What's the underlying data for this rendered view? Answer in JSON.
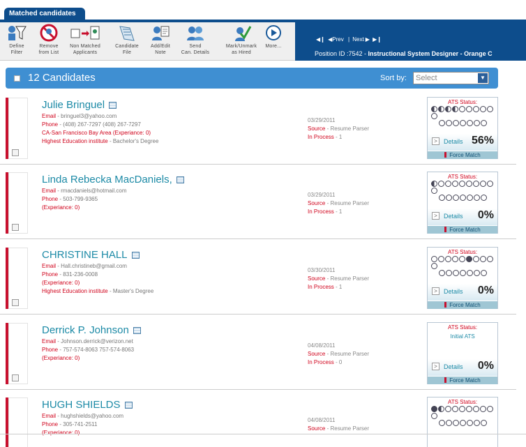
{
  "tab": {
    "label": "Matched candidates"
  },
  "toolbar": {
    "tools": [
      {
        "id": "define-filter",
        "line1": "Define",
        "line2": "Filter"
      },
      {
        "id": "remove-from-list",
        "line1": "Remove",
        "line2": "from List"
      },
      {
        "id": "non-matched",
        "line1": "Non Matched",
        "line2": "Applicants"
      },
      {
        "id": "candidate-file",
        "line1": "Candidate",
        "line2": "File"
      },
      {
        "id": "add-edit-note",
        "line1": "Add/Edit",
        "line2": "Note"
      },
      {
        "id": "send-details",
        "line1": "Send",
        "line2": "Can. Details"
      },
      {
        "id": "mark-hired",
        "line1": "Mark/Unmark",
        "line2": "as Hired"
      },
      {
        "id": "more",
        "line1": "More...",
        "line2": ""
      }
    ],
    "nav": {
      "prev": "Prev",
      "sep": "|",
      "next": "Next"
    },
    "position_label": "Position ID :7542 - ",
    "position_title": "Instructional System Designer - Orange C"
  },
  "header": {
    "count_title": "12 Candidates",
    "sort_label": "Sort by:",
    "sort_value": "Select"
  },
  "candidates": [
    {
      "name": "Julie Bringuel",
      "email_label": "Email",
      "email": "bringuel3@yahoo.com",
      "phone_label": "Phone",
      "phone": "(408) 267-7297 (408) 267-7297",
      "location": "CA-San Francisco Bay Area (Experiance: 0)",
      "edu_label": "Highest Education institute",
      "edu": "Bachelor's Degree",
      "date": "03/29/2011",
      "source_label": "Source",
      "source": "Resume Parser",
      "process_label": "In Process",
      "process": "1",
      "ats_title": "ATS Status:",
      "ats_sub": "",
      "ats_pattern": "hhhhooooooooooooo",
      "details_label": "Details",
      "match": "56%",
      "force_label": "Force Match"
    },
    {
      "name": "Linda Rebecka MacDaniels,",
      "email_label": "Email",
      "email": "rmacdaniels@hotmail.com",
      "phone_label": "Phone",
      "phone": "503-799-9365",
      "location": "(Experiance: 0)",
      "edu_label": "",
      "edu": "",
      "date": "03/29/2011",
      "source_label": "Source",
      "source": "Resume Parser",
      "process_label": "In Process",
      "process": "1",
      "ats_title": "ATS Status:",
      "ats_sub": "",
      "ats_pattern": "hoooooooooooooooo",
      "details_label": "Details",
      "match": "0%",
      "force_label": "Force Match"
    },
    {
      "name": "CHRISTINE HALL",
      "email_label": "Email",
      "email": "Hall.christineb@gmail.com",
      "phone_label": "Phone",
      "phone": "831-236-0008",
      "location": "(Experiance: 0)",
      "edu_label": "Highest Education institute",
      "edu": "Master's Degree",
      "date": "03/30/2011",
      "source_label": "Source",
      "source": "Resume Parser",
      "process_label": "In Process",
      "process": "1",
      "ats_title": "ATS Status:",
      "ats_sub": "",
      "ats_pattern": "ooooofooooooooooo",
      "details_label": "Details",
      "match": "0%",
      "force_label": "Force Match"
    },
    {
      "name": "Derrick P. Johnson",
      "email_label": "Email",
      "email": "Johnson.derrick@verizon.net",
      "phone_label": "Phone",
      "phone": "757-574-8063 757-574-8063",
      "location": "(Experiance: 0)",
      "edu_label": "",
      "edu": "",
      "date": "04/08/2011",
      "source_label": "Source",
      "source": "Resume Parser",
      "process_label": "In Process",
      "process": "0",
      "ats_title": "ATS Status:",
      "ats_sub": "Initial ATS",
      "ats_pattern": "",
      "details_label": "Details",
      "match": "0%",
      "force_label": "Force Match"
    },
    {
      "name": "HUGH SHIELDS",
      "email_label": "Email",
      "email": "hughshields@yahoo.com",
      "phone_label": "Phone",
      "phone": "305-741-2511",
      "location": "(Experiance: 0)",
      "edu_label": "",
      "edu": "",
      "date": "04/08/2011",
      "source_label": "Source",
      "source": "Resume Parser",
      "process_label": "",
      "process": "",
      "ats_title": "ATS Status:",
      "ats_sub": "",
      "ats_pattern": "fhooooooooooooooo",
      "details_label": "",
      "match": "",
      "force_label": ""
    }
  ]
}
